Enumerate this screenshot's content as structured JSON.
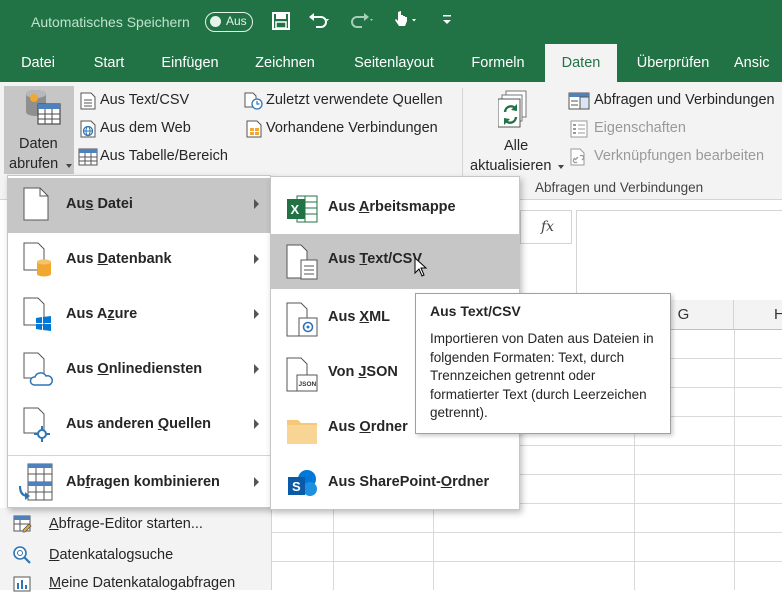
{
  "titlebar": {
    "autosave_label": "Automatisches Speichern",
    "autosave_state": "Aus"
  },
  "tabs": [
    {
      "label": "Datei"
    },
    {
      "label": "Start"
    },
    {
      "label": "Einfügen"
    },
    {
      "label": "Zeichnen"
    },
    {
      "label": "Seitenlayout"
    },
    {
      "label": "Formeln"
    },
    {
      "label": "Daten",
      "active": true
    },
    {
      "label": "Überprüfen"
    },
    {
      "label": "Ansic"
    }
  ],
  "ribbon": {
    "get_data_line1": "Daten",
    "get_data_line2": "abrufen",
    "from_text_csv": "Aus Text/CSV",
    "from_web": "Aus dem Web",
    "from_table": "Aus Tabelle/Bereich",
    "recent_sources": "Zuletzt verwendete Quellen",
    "existing_connections": "Vorhandene Verbindungen",
    "refresh_all_line1": "Alle",
    "refresh_all_line2": "aktualisieren",
    "queries_connections": "Abfragen und Verbindungen",
    "properties": "Eigenschaften",
    "edit_links": "Verknüpfungen bearbeiten",
    "group_queries_label": "Abfragen und Verbindungen"
  },
  "formula_bar": {
    "fx": "fx"
  },
  "columns": [
    {
      "label": "G"
    },
    {
      "label": "H"
    }
  ],
  "menu1": {
    "items": [
      {
        "pre": "Au",
        "key": "s",
        "post": " Datei",
        "highlighted": true
      },
      {
        "pre": "Aus ",
        "key": "D",
        "post": "atenbank"
      },
      {
        "pre": "Aus A",
        "key": "z",
        "post": "ure"
      },
      {
        "pre": "Aus ",
        "key": "O",
        "post": "nlinediensten"
      },
      {
        "pre": "Aus anderen ",
        "key": "Q",
        "post": "uellen"
      },
      {
        "pre": "Ab",
        "key": "f",
        "post": "ragen kombinieren"
      }
    ]
  },
  "bottom_list": {
    "items": [
      {
        "pre": "",
        "key": "A",
        "post": "bfrage-Editor starten..."
      },
      {
        "pre": "",
        "key": "D",
        "post": "atenkatalogsuche"
      },
      {
        "pre": "",
        "key": "M",
        "post": "eine Datenkatalogabfragen"
      }
    ]
  },
  "menu2": {
    "items": [
      {
        "pre": "Aus ",
        "key": "A",
        "post": "rbeitsmappe"
      },
      {
        "pre": "Aus ",
        "key": "T",
        "post": "ext/CSV",
        "highlighted": true
      },
      {
        "pre": "Aus ",
        "key": "X",
        "post": "ML"
      },
      {
        "pre": "Von ",
        "key": "J",
        "post": "SON"
      },
      {
        "pre": "Aus ",
        "key": "O",
        "post": "rdner"
      },
      {
        "pre": "Aus SharePoint-",
        "key": "O",
        "post": "rdner"
      }
    ]
  },
  "tooltip": {
    "title": "Aus Text/CSV",
    "body": "Importieren von Daten aus Dateien in folgenden Formaten: Text, durch Trennzeichen getrennt oder formatierter Text (durch Leerzeichen getrennt)."
  },
  "colors": {
    "brand_green": "#217346",
    "ribbon_bg": "#f3f3f3",
    "menu_highlight": "#c6c6c6"
  }
}
